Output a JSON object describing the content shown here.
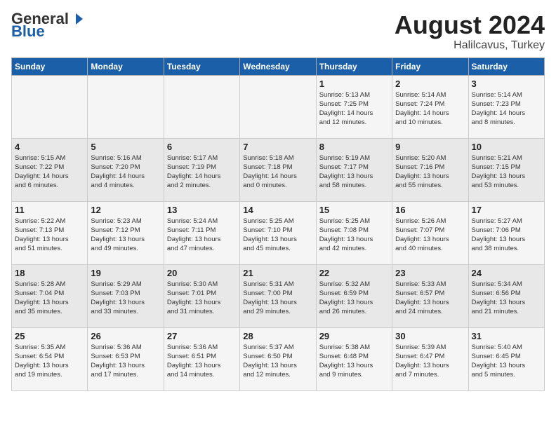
{
  "header": {
    "logo_general": "General",
    "logo_blue": "Blue",
    "month_year": "August 2024",
    "location": "Halilcavus, Turkey"
  },
  "weekdays": [
    "Sunday",
    "Monday",
    "Tuesday",
    "Wednesday",
    "Thursday",
    "Friday",
    "Saturday"
  ],
  "weeks": [
    [
      {
        "day": "",
        "info": ""
      },
      {
        "day": "",
        "info": ""
      },
      {
        "day": "",
        "info": ""
      },
      {
        "day": "",
        "info": ""
      },
      {
        "day": "1",
        "info": "Sunrise: 5:13 AM\nSunset: 7:25 PM\nDaylight: 14 hours\nand 12 minutes."
      },
      {
        "day": "2",
        "info": "Sunrise: 5:14 AM\nSunset: 7:24 PM\nDaylight: 14 hours\nand 10 minutes."
      },
      {
        "day": "3",
        "info": "Sunrise: 5:14 AM\nSunset: 7:23 PM\nDaylight: 14 hours\nand 8 minutes."
      }
    ],
    [
      {
        "day": "4",
        "info": "Sunrise: 5:15 AM\nSunset: 7:22 PM\nDaylight: 14 hours\nand 6 minutes."
      },
      {
        "day": "5",
        "info": "Sunrise: 5:16 AM\nSunset: 7:20 PM\nDaylight: 14 hours\nand 4 minutes."
      },
      {
        "day": "6",
        "info": "Sunrise: 5:17 AM\nSunset: 7:19 PM\nDaylight: 14 hours\nand 2 minutes."
      },
      {
        "day": "7",
        "info": "Sunrise: 5:18 AM\nSunset: 7:18 PM\nDaylight: 14 hours\nand 0 minutes."
      },
      {
        "day": "8",
        "info": "Sunrise: 5:19 AM\nSunset: 7:17 PM\nDaylight: 13 hours\nand 58 minutes."
      },
      {
        "day": "9",
        "info": "Sunrise: 5:20 AM\nSunset: 7:16 PM\nDaylight: 13 hours\nand 55 minutes."
      },
      {
        "day": "10",
        "info": "Sunrise: 5:21 AM\nSunset: 7:15 PM\nDaylight: 13 hours\nand 53 minutes."
      }
    ],
    [
      {
        "day": "11",
        "info": "Sunrise: 5:22 AM\nSunset: 7:13 PM\nDaylight: 13 hours\nand 51 minutes."
      },
      {
        "day": "12",
        "info": "Sunrise: 5:23 AM\nSunset: 7:12 PM\nDaylight: 13 hours\nand 49 minutes."
      },
      {
        "day": "13",
        "info": "Sunrise: 5:24 AM\nSunset: 7:11 PM\nDaylight: 13 hours\nand 47 minutes."
      },
      {
        "day": "14",
        "info": "Sunrise: 5:25 AM\nSunset: 7:10 PM\nDaylight: 13 hours\nand 45 minutes."
      },
      {
        "day": "15",
        "info": "Sunrise: 5:25 AM\nSunset: 7:08 PM\nDaylight: 13 hours\nand 42 minutes."
      },
      {
        "day": "16",
        "info": "Sunrise: 5:26 AM\nSunset: 7:07 PM\nDaylight: 13 hours\nand 40 minutes."
      },
      {
        "day": "17",
        "info": "Sunrise: 5:27 AM\nSunset: 7:06 PM\nDaylight: 13 hours\nand 38 minutes."
      }
    ],
    [
      {
        "day": "18",
        "info": "Sunrise: 5:28 AM\nSunset: 7:04 PM\nDaylight: 13 hours\nand 35 minutes."
      },
      {
        "day": "19",
        "info": "Sunrise: 5:29 AM\nSunset: 7:03 PM\nDaylight: 13 hours\nand 33 minutes."
      },
      {
        "day": "20",
        "info": "Sunrise: 5:30 AM\nSunset: 7:01 PM\nDaylight: 13 hours\nand 31 minutes."
      },
      {
        "day": "21",
        "info": "Sunrise: 5:31 AM\nSunset: 7:00 PM\nDaylight: 13 hours\nand 29 minutes."
      },
      {
        "day": "22",
        "info": "Sunrise: 5:32 AM\nSunset: 6:59 PM\nDaylight: 13 hours\nand 26 minutes."
      },
      {
        "day": "23",
        "info": "Sunrise: 5:33 AM\nSunset: 6:57 PM\nDaylight: 13 hours\nand 24 minutes."
      },
      {
        "day": "24",
        "info": "Sunrise: 5:34 AM\nSunset: 6:56 PM\nDaylight: 13 hours\nand 21 minutes."
      }
    ],
    [
      {
        "day": "25",
        "info": "Sunrise: 5:35 AM\nSunset: 6:54 PM\nDaylight: 13 hours\nand 19 minutes."
      },
      {
        "day": "26",
        "info": "Sunrise: 5:36 AM\nSunset: 6:53 PM\nDaylight: 13 hours\nand 17 minutes."
      },
      {
        "day": "27",
        "info": "Sunrise: 5:36 AM\nSunset: 6:51 PM\nDaylight: 13 hours\nand 14 minutes."
      },
      {
        "day": "28",
        "info": "Sunrise: 5:37 AM\nSunset: 6:50 PM\nDaylight: 13 hours\nand 12 minutes."
      },
      {
        "day": "29",
        "info": "Sunrise: 5:38 AM\nSunset: 6:48 PM\nDaylight: 13 hours\nand 9 minutes."
      },
      {
        "day": "30",
        "info": "Sunrise: 5:39 AM\nSunset: 6:47 PM\nDaylight: 13 hours\nand 7 minutes."
      },
      {
        "day": "31",
        "info": "Sunrise: 5:40 AM\nSunset: 6:45 PM\nDaylight: 13 hours\nand 5 minutes."
      }
    ]
  ]
}
